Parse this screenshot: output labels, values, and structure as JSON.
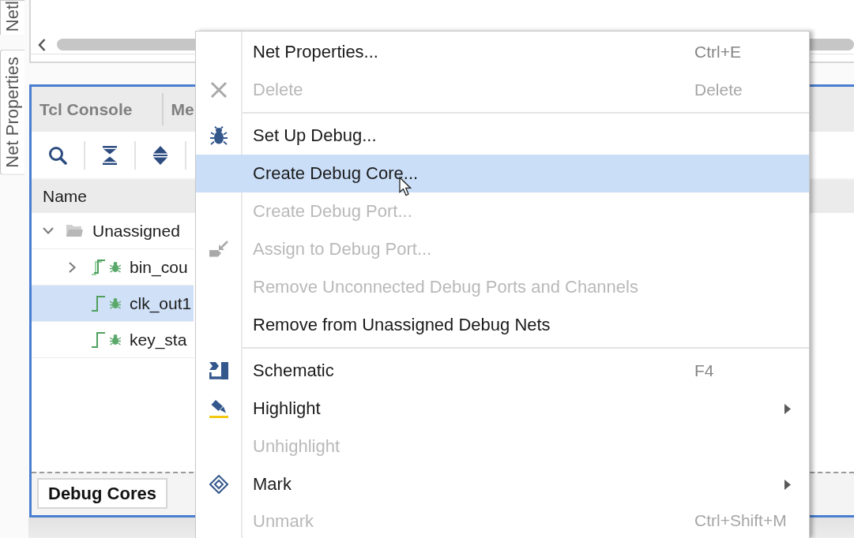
{
  "side_tabs": [
    {
      "label": "Netl",
      "selected": false
    },
    {
      "label": "Net Properties",
      "selected": false
    }
  ],
  "console_panel": {
    "tabs": [
      {
        "label": "Tcl Console",
        "selected": false
      },
      {
        "label": "Me",
        "selected": false
      }
    ],
    "tree": {
      "columns": [
        "Name"
      ],
      "rows": [
        {
          "name": "Unassigned",
          "kind": "folder",
          "expanded": true,
          "selected": false,
          "children": [
            {
              "name": "bin_cou",
              "kind": "bus",
              "expanded": false,
              "selected": false
            },
            {
              "name": "clk_out1",
              "kind": "net",
              "selected": true
            },
            {
              "name": "key_sta",
              "kind": "net",
              "selected": false
            }
          ]
        }
      ]
    },
    "bottom_tabs": [
      {
        "label": "Debug Cores",
        "selected": true
      }
    ]
  },
  "context_menu": {
    "items": [
      {
        "kind": "plain",
        "label": "Net Properties...",
        "shortcut": "Ctrl+E",
        "disabled": false,
        "selected": false,
        "submenu": false
      },
      {
        "kind": "delete",
        "label": "Delete",
        "shortcut": "Delete",
        "disabled": true,
        "selected": false,
        "submenu": false
      },
      {
        "kind": "separator"
      },
      {
        "kind": "debug",
        "label": "Set Up Debug...",
        "disabled": false,
        "selected": false,
        "submenu": false
      },
      {
        "kind": "plain",
        "label": "Create Debug Core...",
        "disabled": false,
        "selected": true,
        "submenu": false
      },
      {
        "kind": "plain",
        "label": "Create Debug Port...",
        "disabled": true,
        "selected": false,
        "submenu": false
      },
      {
        "kind": "assign",
        "label": "Assign to Debug Port...",
        "disabled": true,
        "selected": false,
        "submenu": false
      },
      {
        "kind": "plain",
        "label": "Remove Unconnected Debug Ports and Channels",
        "disabled": true,
        "selected": false,
        "submenu": false
      },
      {
        "kind": "plain",
        "label": "Remove from Unassigned Debug Nets",
        "disabled": false,
        "selected": false,
        "submenu": false
      },
      {
        "kind": "separator"
      },
      {
        "kind": "schematic",
        "label": "Schematic",
        "shortcut": "F4",
        "disabled": false,
        "selected": false,
        "submenu": false
      },
      {
        "kind": "highlight",
        "label": "Highlight",
        "disabled": false,
        "selected": false,
        "submenu": true
      },
      {
        "kind": "plain",
        "label": "Unhighlight",
        "disabled": true,
        "selected": false,
        "submenu": false
      },
      {
        "kind": "mark",
        "label": "Mark",
        "disabled": false,
        "selected": false,
        "submenu": true
      },
      {
        "kind": "plain",
        "label": "Unmark",
        "shortcut": "Ctrl+Shift+M",
        "disabled": true,
        "selected": false,
        "submenu": false
      }
    ]
  }
}
